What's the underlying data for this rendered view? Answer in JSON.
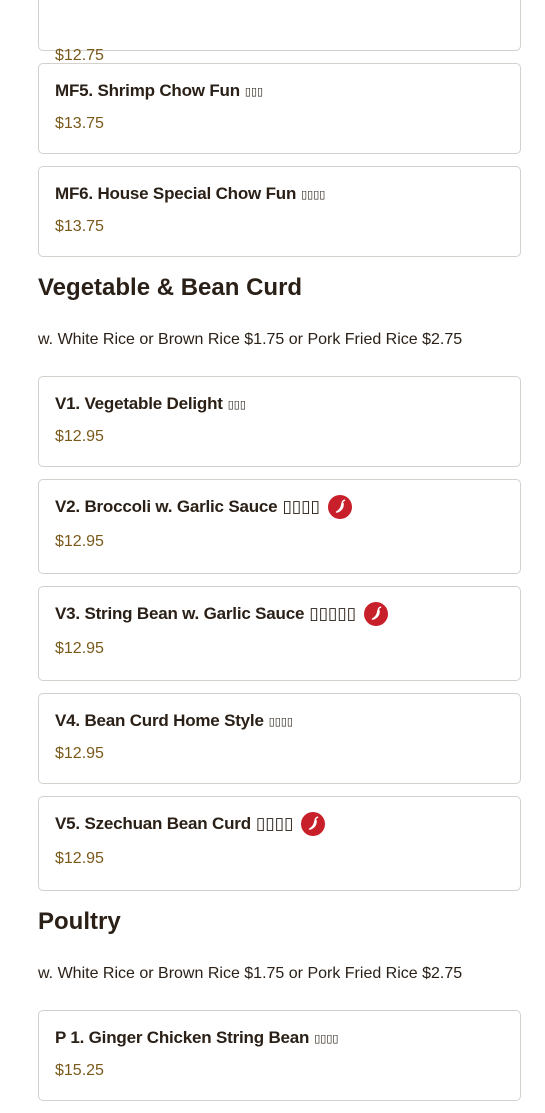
{
  "colors": {
    "price": "#7a5a1c",
    "card_border": "#d4d0cc",
    "chili_red": "#c8202a",
    "text": "#2a2017"
  },
  "top_card": {
    "price": "$12.75"
  },
  "mein_fun_items": [
    {
      "name": "MF5. Shrimp Chow Fun",
      "chinese": "▯▯▯",
      "price": "$13.75",
      "spicy": false
    },
    {
      "name": "MF6. House Special Chow Fun",
      "chinese": "▯▯▯▯",
      "price": "$13.75",
      "spicy": false
    }
  ],
  "sections": [
    {
      "title": "Vegetable & Bean Curd",
      "note": "w. White Rice or Brown Rice $1.75 or Pork Fried Rice $2.75",
      "items": [
        {
          "name": "V1. Vegetable Delight",
          "chinese": "▯▯▯",
          "price": "$12.95",
          "spicy": false,
          "icon": ""
        },
        {
          "name": "V2. Broccoli w. Garlic Sauce",
          "chinese": "▯▯▯▯",
          "price": "$12.95",
          "spicy": true,
          "icon": "chili-pepper-icon"
        },
        {
          "name": "V3. String Bean w. Garlic Sauce",
          "chinese": "▯▯▯▯▯",
          "price": "$12.95",
          "spicy": true,
          "icon": "chili-pepper-icon"
        },
        {
          "name": "V4. Bean Curd Home Style",
          "chinese": "▯▯▯▯",
          "price": "$12.95",
          "spicy": false,
          "icon": ""
        },
        {
          "name": "V5. Szechuan Bean Curd",
          "chinese": "▯▯▯▯",
          "price": "$12.95",
          "spicy": true,
          "icon": "chili-pepper-icon"
        }
      ]
    },
    {
      "title": "Poultry",
      "note": "w. White Rice or Brown Rice $1.75 or Pork Fried Rice $2.75",
      "items": [
        {
          "name": "P 1. Ginger Chicken String Bean",
          "chinese": "▯▯▯▯",
          "price": "$15.25",
          "spicy": false,
          "icon": ""
        }
      ]
    }
  ]
}
